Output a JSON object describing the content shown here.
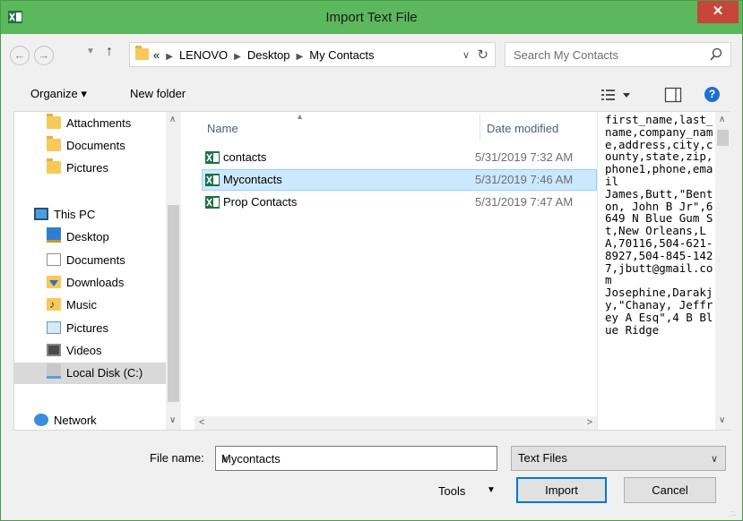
{
  "window": {
    "title": "Import Text File",
    "close_glyph": "✕"
  },
  "nav": {
    "back": "←",
    "forward": "→",
    "up": "↑"
  },
  "address": {
    "overflow": "«",
    "crumbs": [
      "LENOVO",
      "Desktop",
      "My Contacts"
    ],
    "search_placeholder": "Search My Contacts"
  },
  "toolbar": {
    "organize": "Organize ▾",
    "new_folder": "New folder",
    "help": "?"
  },
  "sidebar": {
    "items": [
      {
        "label": "Attachments",
        "icon": "folder-icon"
      },
      {
        "label": "Documents",
        "icon": "folder-icon"
      },
      {
        "label": "Pictures",
        "icon": "folder-icon"
      },
      {
        "label": "This PC",
        "icon": "computer-icon"
      },
      {
        "label": "Desktop",
        "icon": "desktop-icon"
      },
      {
        "label": "Documents",
        "icon": "documents-icon"
      },
      {
        "label": "Downloads",
        "icon": "downloads-icon"
      },
      {
        "label": "Music",
        "icon": "music-icon"
      },
      {
        "label": "Pictures",
        "icon": "pictures-icon"
      },
      {
        "label": "Videos",
        "icon": "videos-icon"
      },
      {
        "label": "Local Disk (C:)",
        "icon": "disk-icon"
      },
      {
        "label": "Network",
        "icon": "network-icon"
      }
    ]
  },
  "files": {
    "columns": {
      "name": "Name",
      "date": "Date modified"
    },
    "rows": [
      {
        "name": "contacts",
        "date": "5/31/2019 7:32 AM"
      },
      {
        "name": "Mycontacts",
        "date": "5/31/2019 7:46 AM"
      },
      {
        "name": "Prop Contacts",
        "date": "5/31/2019 7:47 AM"
      }
    ]
  },
  "preview": {
    "text": "first_name,last_name,company_name,address,city,county,state,zip,phone1,phone,email\nJames,Butt,\"Benton, John B Jr\",6649 N Blue Gum St,New Orleans,LA,70116,504-621-8927,504-845-1427,jbutt@gmail.com\nJosephine,Darakjy,\"Chanay, Jeffrey A Esq\",4 B Blue Ridge"
  },
  "bottom": {
    "file_name_label": "File name:",
    "file_name_value": "Mycontacts",
    "filter": "Text Files",
    "tools": "Tools",
    "import": "Import",
    "cancel": "Cancel"
  },
  "colors": {
    "titlebar": "#5cb85c",
    "selection": "#cce8ff",
    "close": "#c7463a"
  }
}
